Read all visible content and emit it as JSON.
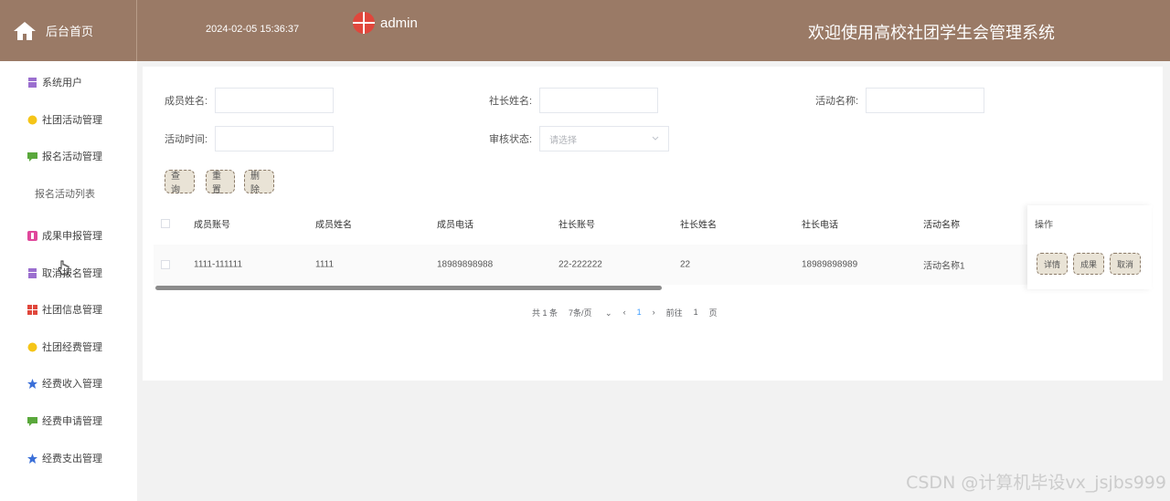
{
  "header": {
    "home_label": "后台首页",
    "datetime": "2024-02-05 15:36:37",
    "username": "admin",
    "system_title": "欢迎使用高校社团学生会管理系统"
  },
  "sidebar": {
    "items": [
      {
        "label": "系统用户",
        "icon": "user-group-icon",
        "color": "#9b6fcf"
      },
      {
        "label": "社团活动管理",
        "icon": "circle-icon",
        "color": "#f5c518"
      },
      {
        "label": "报名活动管理",
        "icon": "message-icon",
        "color": "#5aa83c"
      },
      {
        "label": "报名活动列表",
        "icon": "",
        "color": ""
      },
      {
        "label": "成果申报管理",
        "icon": "gift-icon",
        "color": "#e0479b"
      },
      {
        "label": "取消报名管理",
        "icon": "user-group-icon",
        "color": "#9b6fcf"
      },
      {
        "label": "社团信息管理",
        "icon": "grid-icon",
        "color": "#e0473c"
      },
      {
        "label": "社团经费管理",
        "icon": "circle-icon",
        "color": "#f5c518"
      },
      {
        "label": "经费收入管理",
        "icon": "star-icon",
        "color": "#3a6fd8"
      },
      {
        "label": "经费申请管理",
        "icon": "message-icon",
        "color": "#5aa83c"
      },
      {
        "label": "经费支出管理",
        "icon": "star-icon",
        "color": "#3a6fd8"
      }
    ]
  },
  "search": {
    "member_name_label": "成员姓名:",
    "president_name_label": "社长姓名:",
    "activity_name_label": "活动名称:",
    "activity_time_label": "活动时间:",
    "audit_status_label": "审核状态:",
    "audit_status_placeholder": "请选择",
    "query_btn": "查询",
    "reset_btn": "重置",
    "delete_btn": "删除"
  },
  "table": {
    "columns": [
      "成员账号",
      "成员姓名",
      "成员电话",
      "社长账号",
      "社长姓名",
      "社长电话",
      "活动名称",
      "操作"
    ],
    "rows": [
      {
        "cells": [
          "1111-111111",
          "1111",
          "18989898988",
          "22-222222",
          "22",
          "18989898989",
          "活动名称1"
        ]
      }
    ],
    "actions": [
      "详情",
      "成果",
      "取消"
    ]
  },
  "pagination": {
    "total": "共 1 条",
    "page_size": "7条/页",
    "prev": "‹",
    "current": "1",
    "next": "›",
    "goto": "前往",
    "goto_value": "1",
    "page_unit": "页"
  },
  "watermark": "CSDN @计算机毕设vx_jsjbs999",
  "colors": {
    "header_bg": "#9a7a66",
    "button_bg": "#e9e3d6",
    "accent": "#409eff"
  }
}
